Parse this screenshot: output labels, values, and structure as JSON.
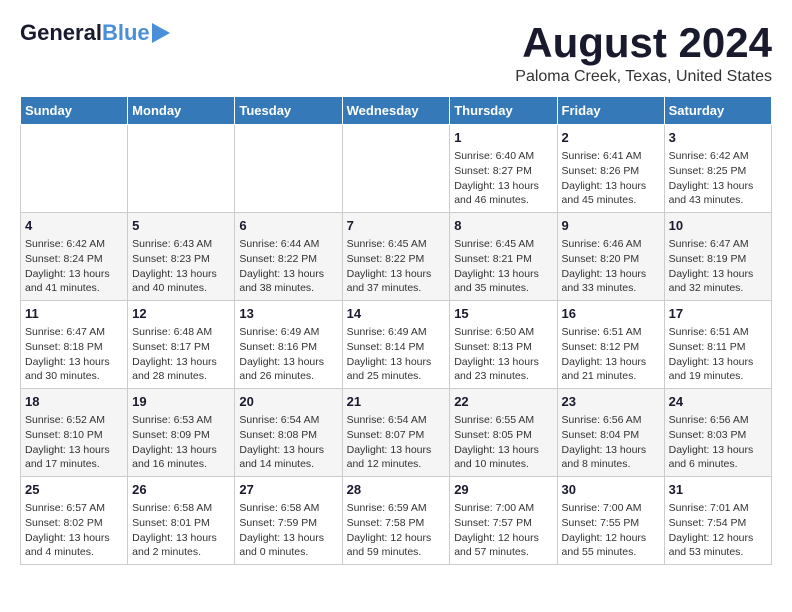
{
  "header": {
    "logo_general": "General",
    "logo_blue": "Blue",
    "main_title": "August 2024",
    "subtitle": "Paloma Creek, Texas, United States"
  },
  "calendar": {
    "weekdays": [
      "Sunday",
      "Monday",
      "Tuesday",
      "Wednesday",
      "Thursday",
      "Friday",
      "Saturday"
    ],
    "weeks": [
      [
        {
          "day": "",
          "info": ""
        },
        {
          "day": "",
          "info": ""
        },
        {
          "day": "",
          "info": ""
        },
        {
          "day": "",
          "info": ""
        },
        {
          "day": "1",
          "info": "Sunrise: 6:40 AM\nSunset: 8:27 PM\nDaylight: 13 hours\nand 46 minutes."
        },
        {
          "day": "2",
          "info": "Sunrise: 6:41 AM\nSunset: 8:26 PM\nDaylight: 13 hours\nand 45 minutes."
        },
        {
          "day": "3",
          "info": "Sunrise: 6:42 AM\nSunset: 8:25 PM\nDaylight: 13 hours\nand 43 minutes."
        }
      ],
      [
        {
          "day": "4",
          "info": "Sunrise: 6:42 AM\nSunset: 8:24 PM\nDaylight: 13 hours\nand 41 minutes."
        },
        {
          "day": "5",
          "info": "Sunrise: 6:43 AM\nSunset: 8:23 PM\nDaylight: 13 hours\nand 40 minutes."
        },
        {
          "day": "6",
          "info": "Sunrise: 6:44 AM\nSunset: 8:22 PM\nDaylight: 13 hours\nand 38 minutes."
        },
        {
          "day": "7",
          "info": "Sunrise: 6:45 AM\nSunset: 8:22 PM\nDaylight: 13 hours\nand 37 minutes."
        },
        {
          "day": "8",
          "info": "Sunrise: 6:45 AM\nSunset: 8:21 PM\nDaylight: 13 hours\nand 35 minutes."
        },
        {
          "day": "9",
          "info": "Sunrise: 6:46 AM\nSunset: 8:20 PM\nDaylight: 13 hours\nand 33 minutes."
        },
        {
          "day": "10",
          "info": "Sunrise: 6:47 AM\nSunset: 8:19 PM\nDaylight: 13 hours\nand 32 minutes."
        }
      ],
      [
        {
          "day": "11",
          "info": "Sunrise: 6:47 AM\nSunset: 8:18 PM\nDaylight: 13 hours\nand 30 minutes."
        },
        {
          "day": "12",
          "info": "Sunrise: 6:48 AM\nSunset: 8:17 PM\nDaylight: 13 hours\nand 28 minutes."
        },
        {
          "day": "13",
          "info": "Sunrise: 6:49 AM\nSunset: 8:16 PM\nDaylight: 13 hours\nand 26 minutes."
        },
        {
          "day": "14",
          "info": "Sunrise: 6:49 AM\nSunset: 8:14 PM\nDaylight: 13 hours\nand 25 minutes."
        },
        {
          "day": "15",
          "info": "Sunrise: 6:50 AM\nSunset: 8:13 PM\nDaylight: 13 hours\nand 23 minutes."
        },
        {
          "day": "16",
          "info": "Sunrise: 6:51 AM\nSunset: 8:12 PM\nDaylight: 13 hours\nand 21 minutes."
        },
        {
          "day": "17",
          "info": "Sunrise: 6:51 AM\nSunset: 8:11 PM\nDaylight: 13 hours\nand 19 minutes."
        }
      ],
      [
        {
          "day": "18",
          "info": "Sunrise: 6:52 AM\nSunset: 8:10 PM\nDaylight: 13 hours\nand 17 minutes."
        },
        {
          "day": "19",
          "info": "Sunrise: 6:53 AM\nSunset: 8:09 PM\nDaylight: 13 hours\nand 16 minutes."
        },
        {
          "day": "20",
          "info": "Sunrise: 6:54 AM\nSunset: 8:08 PM\nDaylight: 13 hours\nand 14 minutes."
        },
        {
          "day": "21",
          "info": "Sunrise: 6:54 AM\nSunset: 8:07 PM\nDaylight: 13 hours\nand 12 minutes."
        },
        {
          "day": "22",
          "info": "Sunrise: 6:55 AM\nSunset: 8:05 PM\nDaylight: 13 hours\nand 10 minutes."
        },
        {
          "day": "23",
          "info": "Sunrise: 6:56 AM\nSunset: 8:04 PM\nDaylight: 13 hours\nand 8 minutes."
        },
        {
          "day": "24",
          "info": "Sunrise: 6:56 AM\nSunset: 8:03 PM\nDaylight: 13 hours\nand 6 minutes."
        }
      ],
      [
        {
          "day": "25",
          "info": "Sunrise: 6:57 AM\nSunset: 8:02 PM\nDaylight: 13 hours\nand 4 minutes."
        },
        {
          "day": "26",
          "info": "Sunrise: 6:58 AM\nSunset: 8:01 PM\nDaylight: 13 hours\nand 2 minutes."
        },
        {
          "day": "27",
          "info": "Sunrise: 6:58 AM\nSunset: 7:59 PM\nDaylight: 13 hours\nand 0 minutes."
        },
        {
          "day": "28",
          "info": "Sunrise: 6:59 AM\nSunset: 7:58 PM\nDaylight: 12 hours\nand 59 minutes."
        },
        {
          "day": "29",
          "info": "Sunrise: 7:00 AM\nSunset: 7:57 PM\nDaylight: 12 hours\nand 57 minutes."
        },
        {
          "day": "30",
          "info": "Sunrise: 7:00 AM\nSunset: 7:55 PM\nDaylight: 12 hours\nand 55 minutes."
        },
        {
          "day": "31",
          "info": "Sunrise: 7:01 AM\nSunset: 7:54 PM\nDaylight: 12 hours\nand 53 minutes."
        }
      ]
    ]
  }
}
